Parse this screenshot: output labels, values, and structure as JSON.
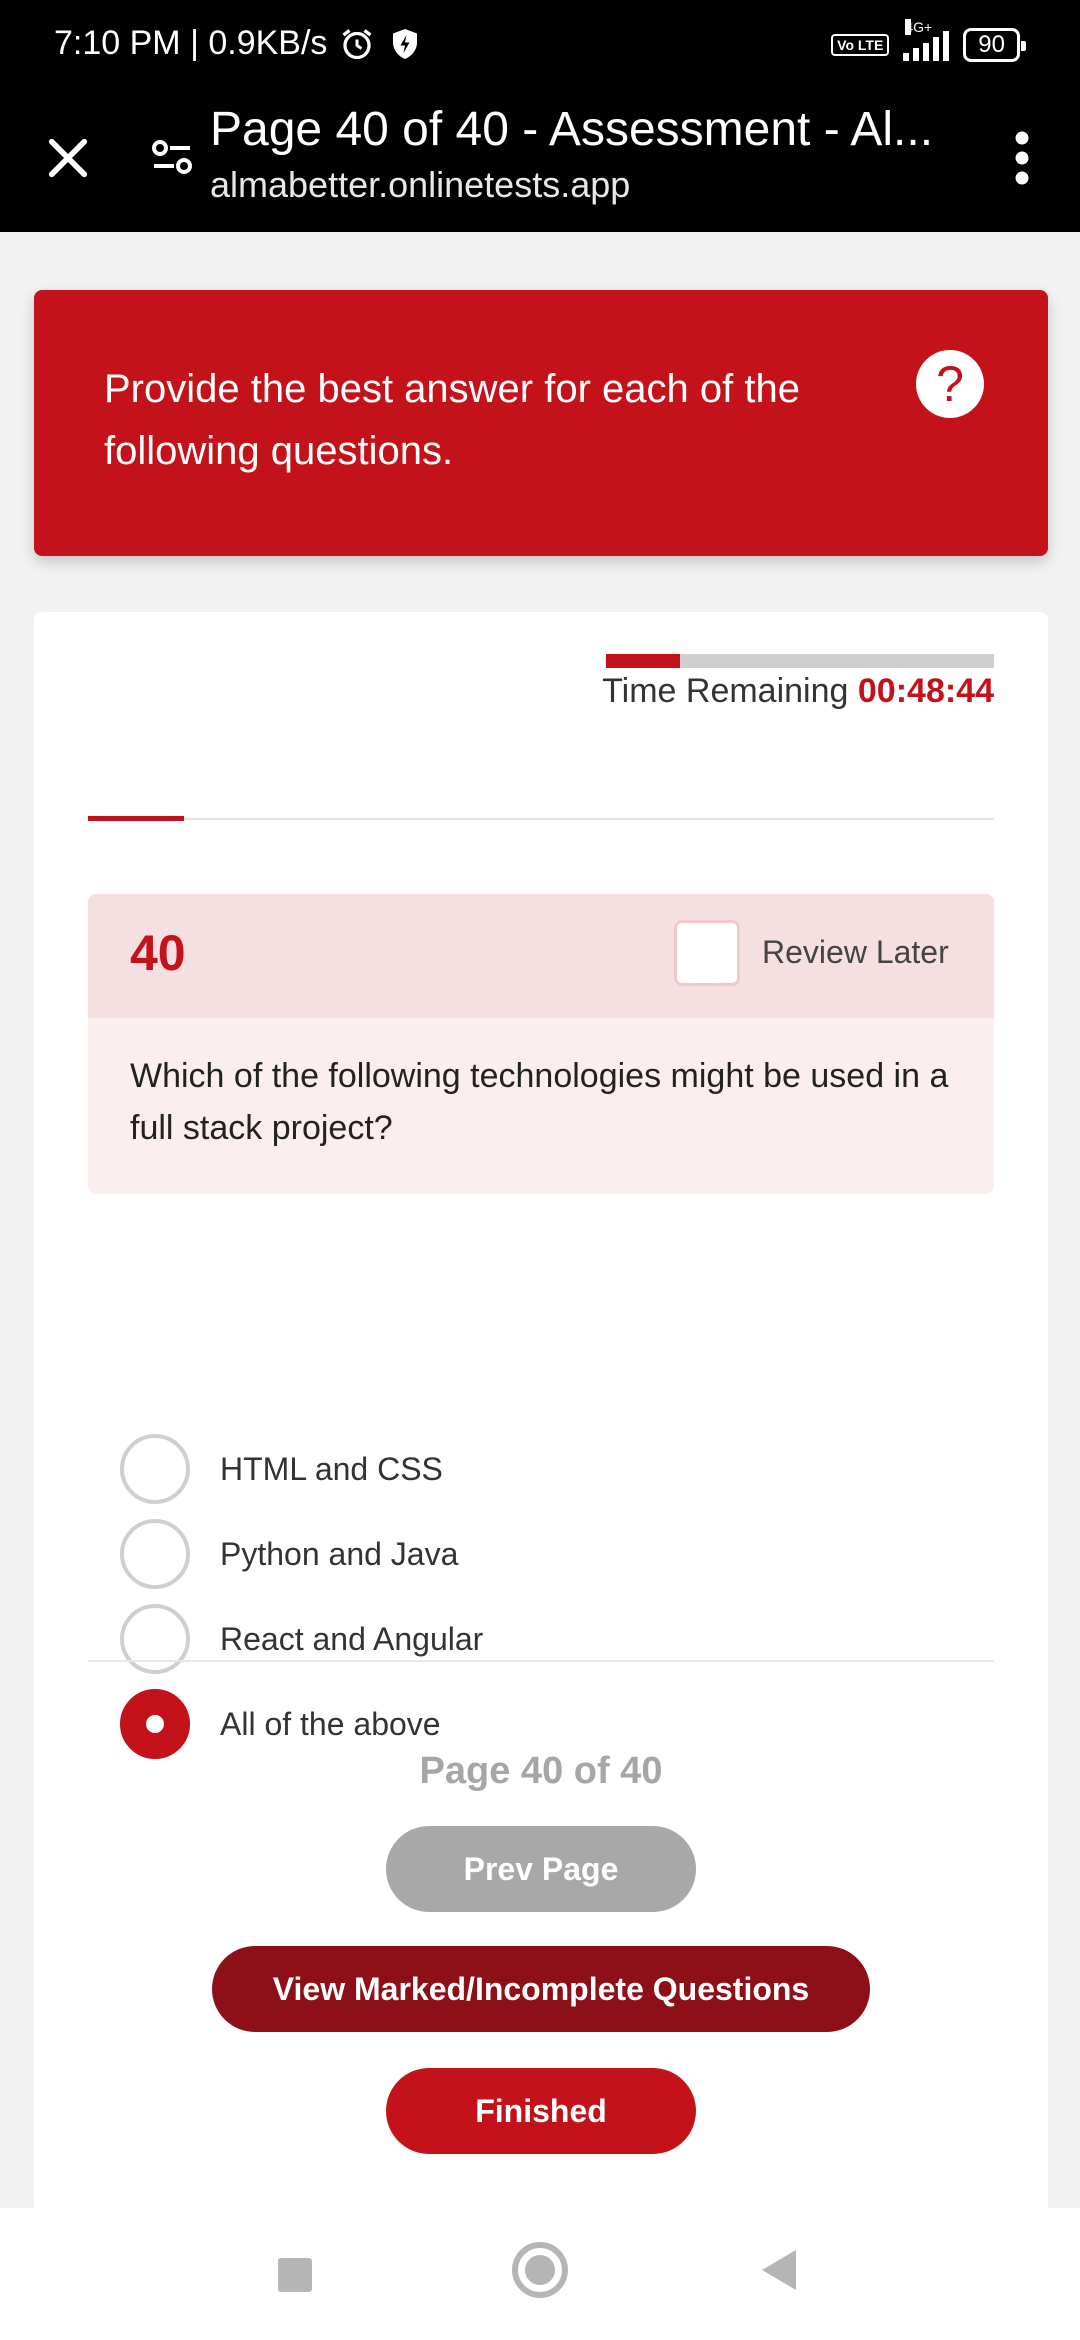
{
  "status_bar": {
    "time_speed": "7:10 PM | 0.9KB/s",
    "network_type": "4G+",
    "volte": "Vo LTE",
    "battery": "90",
    "icons": [
      "alarm-icon",
      "shield-bolt-icon",
      "signal-icon",
      "battery-icon"
    ]
  },
  "browser": {
    "title": "Page 40 of 40 - Assessment - Al...",
    "url": "almabetter.onlinetests.app",
    "icons": [
      "close-icon",
      "tune-icon",
      "more-vert-icon"
    ]
  },
  "instructions": {
    "text": "Provide the best answer for each of the following questions.",
    "help_label": "?"
  },
  "timer": {
    "label": "Time Remaining",
    "value": "00:48:44",
    "progress_fraction": 0.19
  },
  "question": {
    "number": "40",
    "review_label": "Review Later",
    "text": "Which of the following technologies might be used in a full stack project?",
    "options": [
      {
        "label": "HTML and CSS",
        "selected": false
      },
      {
        "label": "Python and Java",
        "selected": false
      },
      {
        "label": "React and Angular",
        "selected": false
      },
      {
        "label": "All of the above",
        "selected": true
      }
    ]
  },
  "pagination": {
    "page_text": "Page 40 of 40",
    "prev_label": "Prev Page",
    "marked_label": "View Marked/Incomplete Questions",
    "finish_label": "Finished"
  },
  "colors": {
    "accent": "#c4121a",
    "accent_dark": "#8d0f17",
    "disabled": "#a8a8a8"
  },
  "nav_bar": {
    "icons": [
      "recents-icon",
      "home-icon",
      "back-icon"
    ]
  }
}
